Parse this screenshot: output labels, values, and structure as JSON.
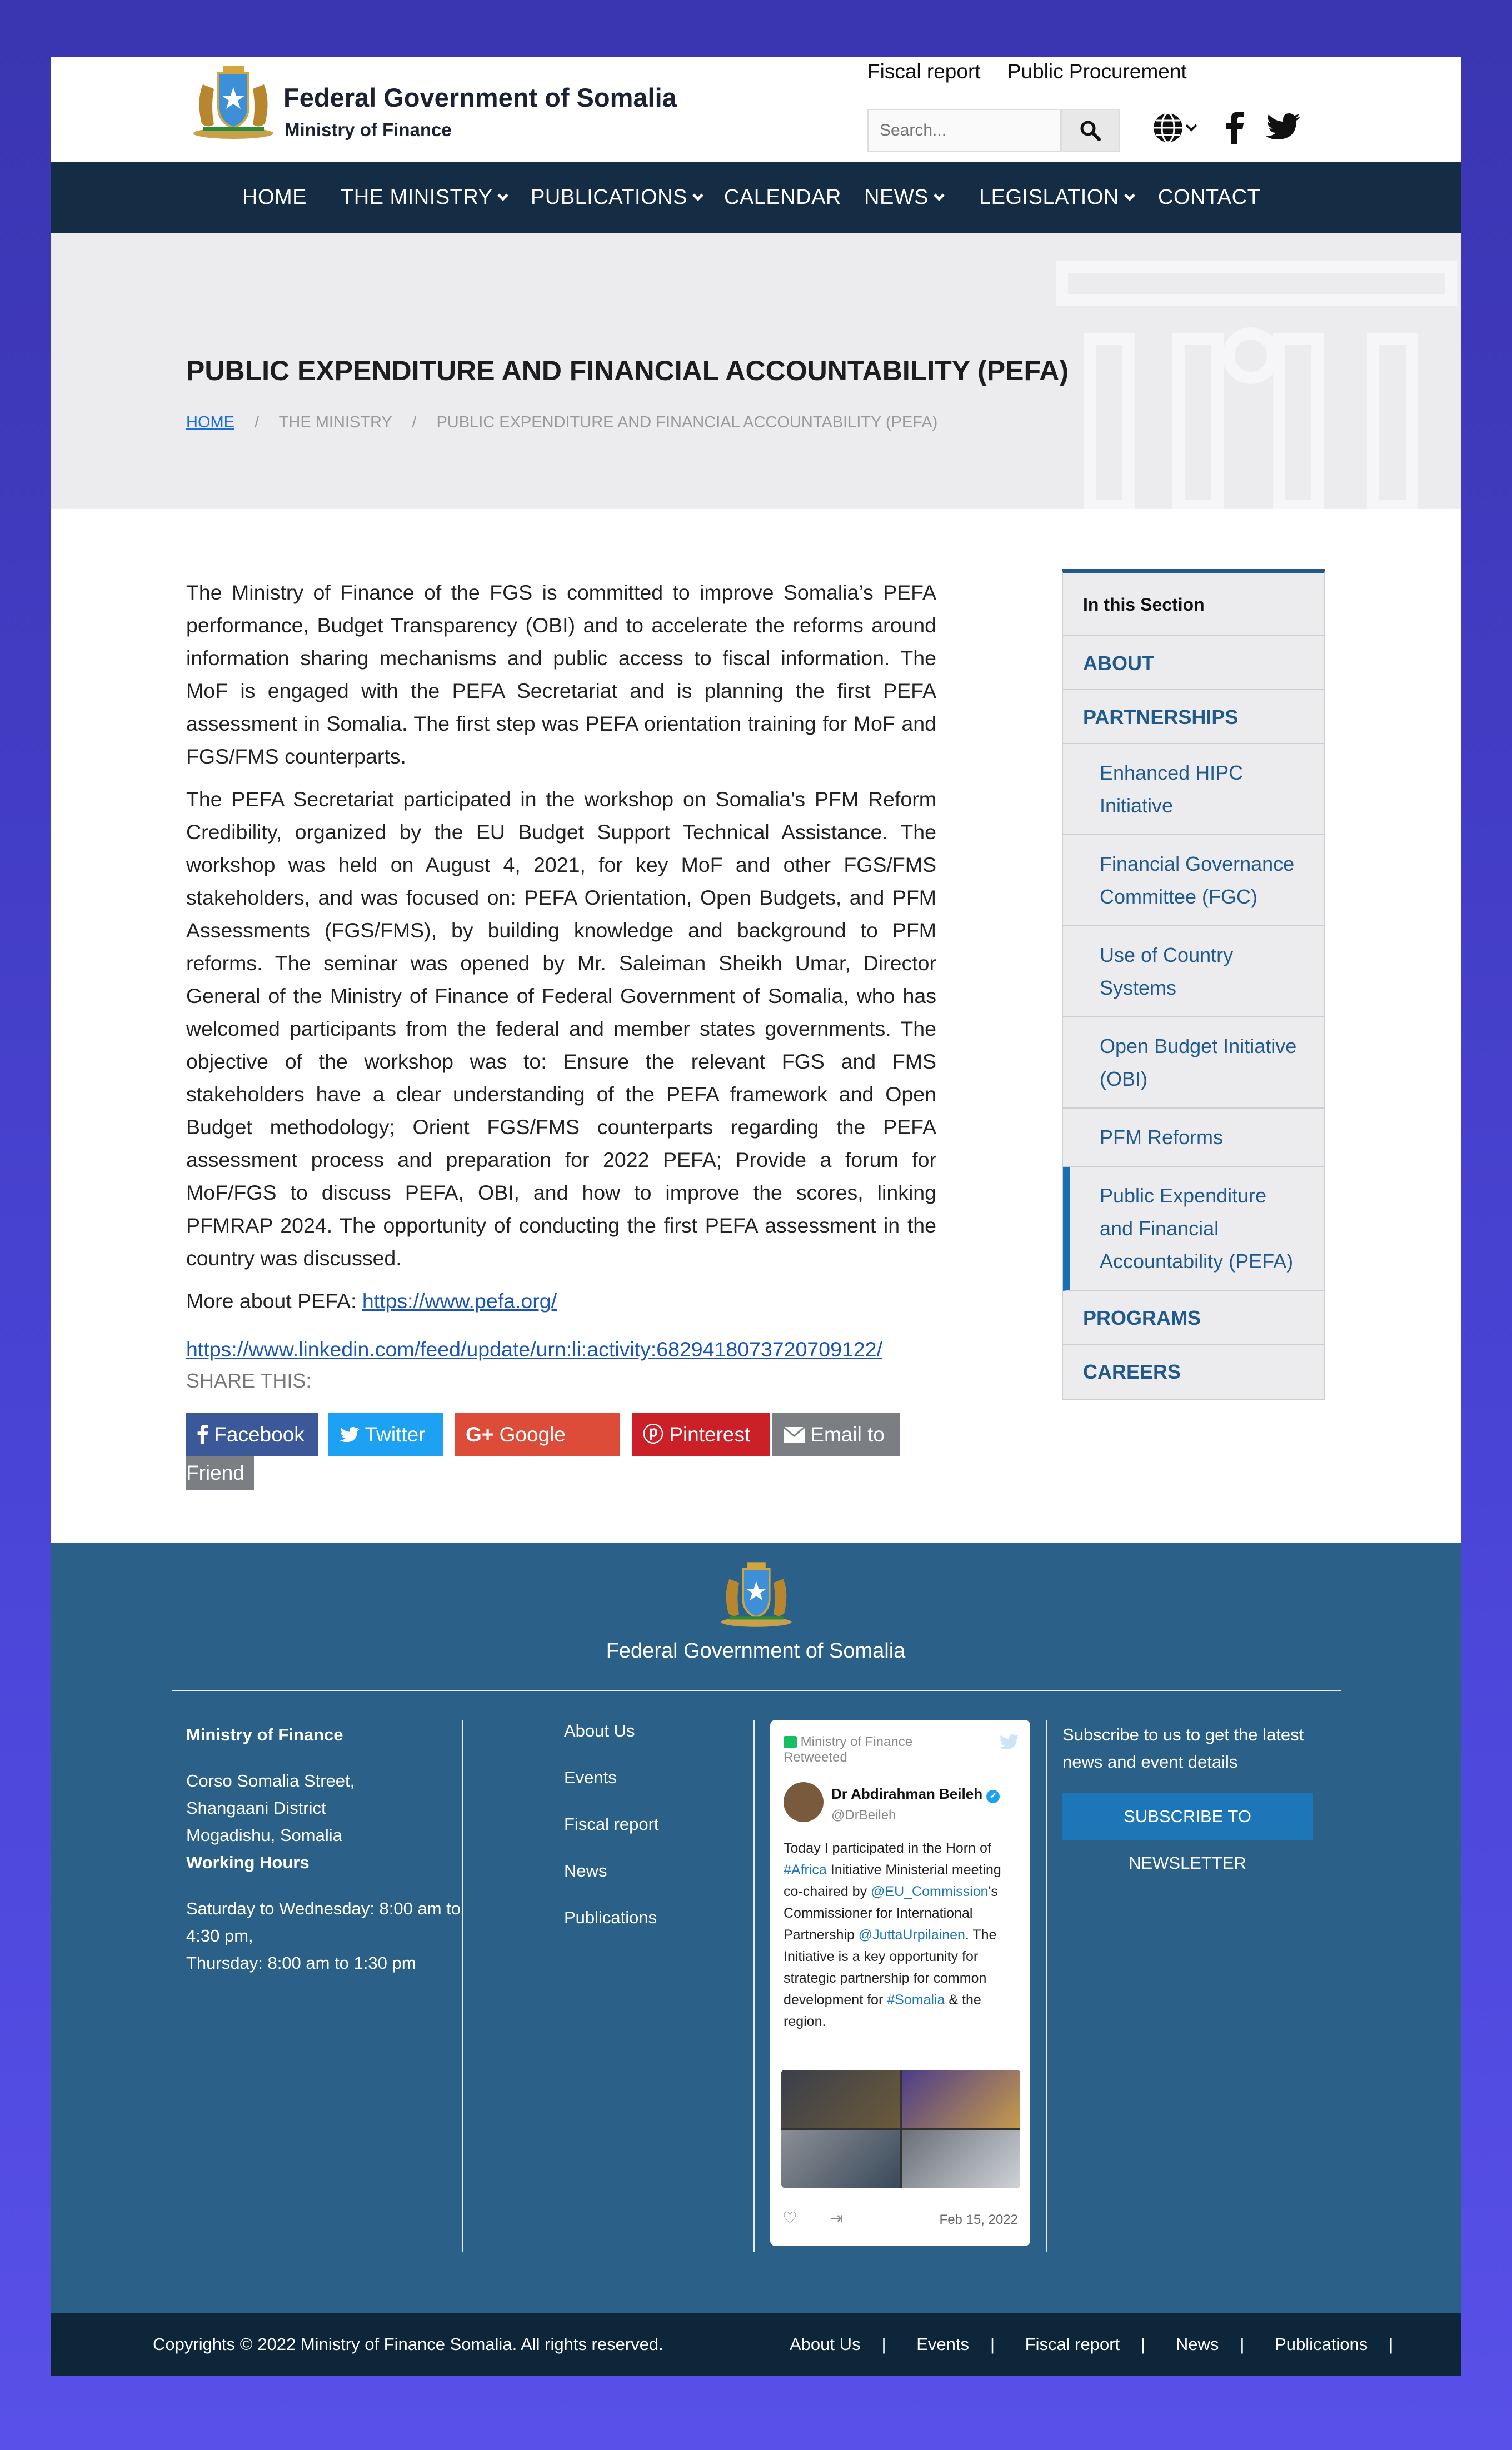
{
  "header": {
    "brand_title": "Federal Government of Somalia",
    "brand_sub": "Ministry of Finance",
    "top_links": [
      "Fiscal report",
      "Public Procurement"
    ],
    "search_placeholder": "Search...",
    "icons": [
      "globe-icon",
      "facebook-icon",
      "twitter-icon"
    ]
  },
  "nav": {
    "items": [
      "HOME",
      "THE MINISTRY",
      "PUBLICATIONS",
      "CALENDAR",
      "NEWS",
      "LEGISLATION",
      "CONTACT"
    ]
  },
  "hero": {
    "title": "PUBLIC EXPENDITURE AND FINANCIAL ACCOUNTABILITY (PEFA)",
    "breadcrumb": [
      "HOME",
      "THE MINISTRY",
      "PUBLIC EXPENDITURE AND FINANCIAL ACCOUNTABILITY (PEFA)"
    ],
    "crumb_sep": "/"
  },
  "article": {
    "p1": "The Ministry of Finance of the FGS is committed to improve Somalia’s PEFA performance, Budget Transparency (OBI) and to accelerate the reforms around information sharing mechanisms and public access to fiscal information. The MoF is engaged with the PEFA Secretariat and is planning the first PEFA assessment in Somalia. The first step was PEFA orientation training for MoF and FGS/FMS counterparts.",
    "p2": "The PEFA Secretariat participated in the workshop on Somalia's PFM Reform Credibility, organized by the EU Budget Support Technical Assistance. The workshop was held on August 4, 2021, for key MoF and other FGS/FMS stakeholders, and was focused on: PEFA Orientation, Open Budgets, and PFM Assessments (FGS/FMS), by building knowledge and background to PFM reforms. The seminar was opened by Mr. Saleiman Sheikh Umar, Director General of the Ministry of Finance of Federal Government of Somalia, who has welcomed participants from the federal and member states governments. The objective of the workshop was to: Ensure the relevant FGS and FMS stakeholders have a clear understanding of the PEFA framework and Open Budget methodology; Orient FGS/FMS counterparts regarding the PEFA assessment process and preparation for 2022 PEFA; Provide a forum for MoF/FGS to discuss PEFA, OBI, and how to improve the scores, linking PFMRAP 2024. The opportunity of conducting the first PEFA assessment in the country was discussed.",
    "more_label": "More about PEFA: ",
    "pefa_link": "https://www.pefa.org/",
    "linkedin_link": "https://www.linkedin.com/feed/update/urn:li:activity:6829418073720709122/"
  },
  "share": {
    "label": "SHARE THIS:",
    "buttons": [
      {
        "label": "Facebook",
        "color": "#3b5998",
        "icon": "facebook-icon"
      },
      {
        "label": "Twitter",
        "color": "#1da1f2",
        "icon": "twitter-icon"
      },
      {
        "label": "Google Plus",
        "color": "#dd4b39",
        "icon": "google-plus-icon"
      },
      {
        "label": "Pinterest",
        "color": "#cb2027",
        "icon": "pinterest-icon"
      },
      {
        "label": "Email to a",
        "label2": "Friend",
        "color": "#7b7f83",
        "icon": "envelope-icon"
      }
    ]
  },
  "sidebar": {
    "heading": "In this Section",
    "about": "ABOUT",
    "partnerships": "PARTNERSHIPS",
    "sub": [
      "Enhanced HIPC Initiative",
      "Financial Governance Committee (FGC)",
      "Use of Country Systems",
      "Open Budget Initiative (OBI)",
      "PFM Reforms",
      "Public Expenditure and Financial Accountability (PEFA)"
    ],
    "programs": "PROGRAMS",
    "careers": "CAREERS"
  },
  "footer": {
    "title": "Federal Government of Somalia",
    "org": "Ministry of Finance",
    "address": [
      "Corso Somalia Street,",
      "Shangaani District",
      "Mogadishu, Somalia"
    ],
    "hours_label": "Working Hours",
    "hours": [
      "Saturday to Wednesday: 8:00 am to",
      "4:30 pm,",
      "Thursday: 8:00 am to 1:30 pm"
    ],
    "links": [
      "About Us",
      "Events",
      "Fiscal report",
      "News",
      "Publications"
    ],
    "subscribe_text": "Subscribe to us to get the latest news and event details",
    "subscribe_btn": "SUBSCRIBE TO NEWSLETTER"
  },
  "tweet": {
    "retweeted_by": "Ministry of Finance",
    "retweeted": "Retweeted",
    "author": "Dr Abdirahman Beileh",
    "handle": "@DrBeileh",
    "text_parts": [
      "Today I participated in the Horn of ",
      "#Africa",
      " Initiative Ministerial meeting co-chaired by ",
      "@EU_Commission",
      "'s Commissioner for International Partnership ",
      "@JuttaUrpilainen",
      ". The Initiative is a key opportunity for strategic partnership for common development for ",
      "#Somalia",
      " & the region."
    ],
    "date": "Feb 15, 2022"
  },
  "bottom": {
    "copyright": "Copyrights © 2022 Ministry of Finance Somalia. All rights reserved.",
    "links": [
      "About Us",
      "Events",
      "Fiscal report",
      "News",
      "Publications"
    ],
    "sep": "|"
  },
  "colors": {
    "nav_bg": "#142c44",
    "accent_blue": "#215a8a",
    "footer_bg": "#2b6088",
    "bottom_bg": "#0e2639"
  }
}
